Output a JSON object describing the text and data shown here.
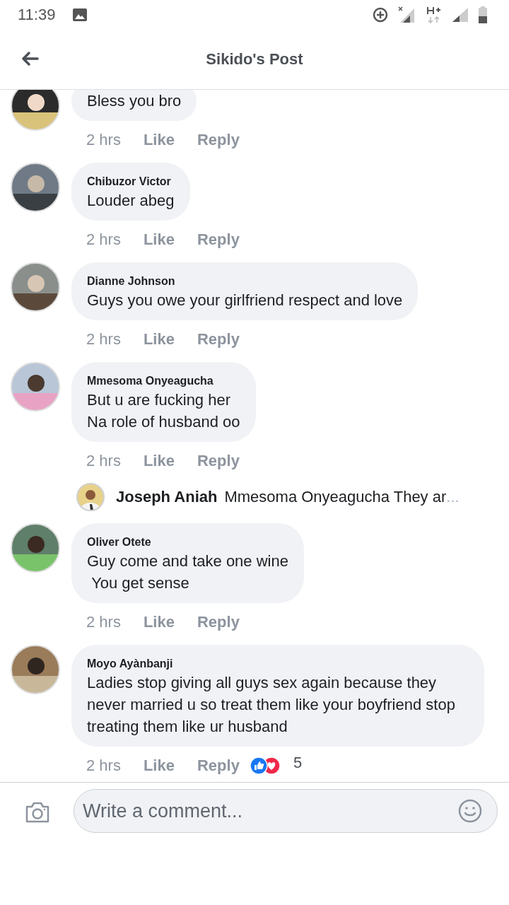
{
  "status_bar": {
    "time": "11:39"
  },
  "header": {
    "title": "Sikido's Post"
  },
  "comments": [
    {
      "text": "Bless you bro",
      "time": "2 hrs",
      "like": "Like",
      "reply": "Reply"
    },
    {
      "author": "Chibuzor Victor",
      "text": "Louder abeg",
      "time": "2 hrs",
      "like": "Like",
      "reply": "Reply"
    },
    {
      "author": "Dianne Johnson",
      "text": "Guys you owe your girlfriend respect and love",
      "time": "2 hrs",
      "like": "Like",
      "reply": "Reply"
    },
    {
      "author": "Mmesoma Onyeagucha",
      "text": "But u are fucking her\nNa role of husband oo",
      "time": "2 hrs",
      "like": "Like",
      "reply": "Reply",
      "reply_preview": {
        "author": "Joseph Aniah",
        "text": "Mmesoma Onyeagucha They ar",
        "ellipsis": "..."
      }
    },
    {
      "author": "Oliver Otete",
      "text": "Guy come and take one wine\n You get sense",
      "time": "2 hrs",
      "like": "Like",
      "reply": "Reply"
    },
    {
      "author": "Moyo Ayànbanji",
      "text": "Ladies stop giving all guys sex again because they never married u so treat them like your boyfriend stop treating them like ur husband",
      "time": "2 hrs",
      "like": "Like",
      "reply": "Reply",
      "reactions": {
        "count": "5"
      }
    }
  ],
  "composer": {
    "placeholder": "Write a comment..."
  }
}
